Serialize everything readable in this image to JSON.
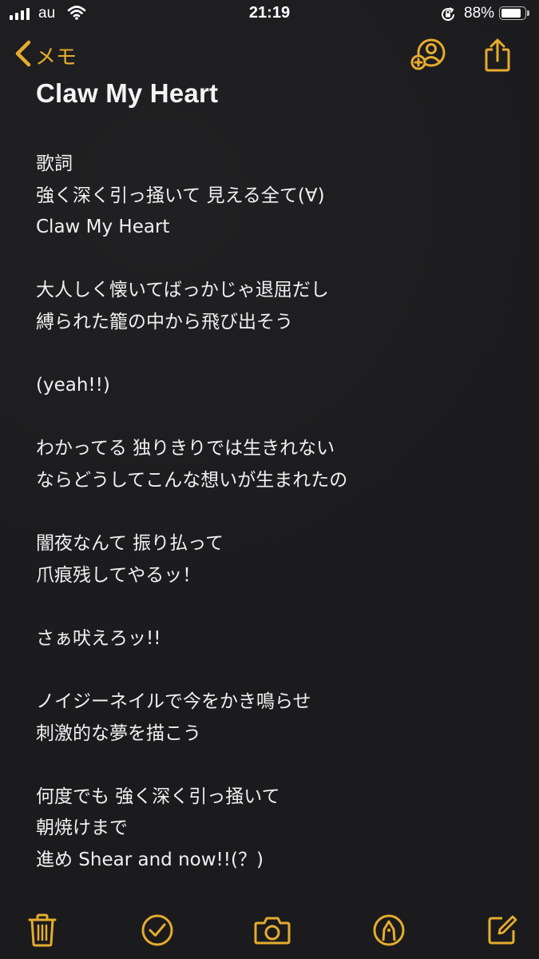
{
  "status_bar": {
    "carrier": "au",
    "time": "21:19",
    "battery_percent_label": "88%",
    "battery_level": 0.88
  },
  "nav": {
    "back_label": "メモ"
  },
  "note": {
    "title": "Claw My Heart",
    "lines": [
      "歌詞",
      "強く深く引っ掻いて 見える全て(∀)",
      "Claw My Heart",
      "",
      "大人しく懐いてばっかじゃ退屈だし",
      "縛られた籠の中から飛び出そう",
      "",
      "(yeah!!)",
      "",
      "わかってる 独りきりでは生きれない",
      "ならどうしてこんな想いが生まれたの",
      "",
      "闇夜なんて 振り払って",
      "爪痕残してやるッ！",
      "",
      "さぁ吠えろッ!!",
      "",
      "ノイジーネイルで今をかき鳴らせ",
      "刺激的な夢を描こう",
      "",
      "何度でも 強く深く引っ掻いて",
      "朝焼けまで",
      "進め Shear and now!!(？)"
    ]
  },
  "colors": {
    "accent": "#e5ac2f",
    "background": "#1b1b1d",
    "text": "#f0f0f0"
  },
  "icons": {
    "back": "chevron-left-icon",
    "collaborate": "add-person-icon",
    "share": "share-icon",
    "delete": "trash-icon",
    "checklist": "checkmark-circle-icon",
    "camera": "camera-icon",
    "markup": "pen-tip-circle-icon",
    "compose": "compose-icon"
  }
}
